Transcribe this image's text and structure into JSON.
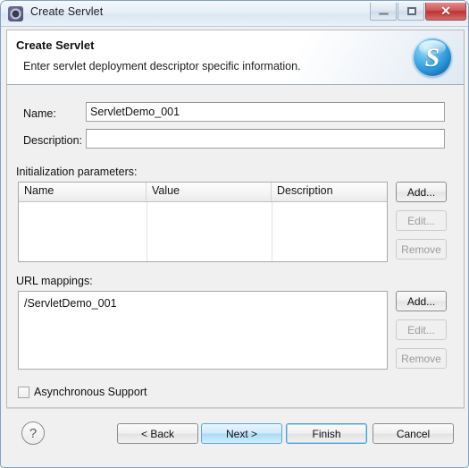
{
  "window": {
    "title": "Create Servlet",
    "icon": "servlet-gear-icon",
    "controls": {
      "minimize": "minimize-icon",
      "maximize": "maximize-icon",
      "close": "✕"
    }
  },
  "banner": {
    "title": "Create Servlet",
    "subtitle": "Enter servlet deployment descriptor specific information.",
    "logo": "S"
  },
  "form": {
    "name_label": "Name:",
    "name_value": "ServletDemo_001",
    "description_label": "Description:",
    "description_value": ""
  },
  "init_params": {
    "section_label": "Initialization parameters:",
    "columns": [
      "Name",
      "Value",
      "Description"
    ],
    "rows": [],
    "buttons": [
      {
        "label": "Add...",
        "enabled": true
      },
      {
        "label": "Edit...",
        "enabled": false
      },
      {
        "label": "Remove",
        "enabled": false
      }
    ]
  },
  "url_mappings": {
    "section_label": "URL mappings:",
    "items": [
      "/ServletDemo_001"
    ],
    "buttons": [
      {
        "label": "Add...",
        "enabled": true
      },
      {
        "label": "Edit...",
        "enabled": false
      },
      {
        "label": "Remove",
        "enabled": false
      }
    ]
  },
  "async": {
    "label": "Asynchronous Support",
    "checked": false
  },
  "footer": {
    "help": "?",
    "back": "< Back",
    "next": "Next >",
    "finish": "Finish",
    "cancel": "Cancel"
  },
  "colors": {
    "window_border": "#7ea2c4",
    "dialog_bg": "#f0f0f0",
    "accent_blue": "#2f9bdc",
    "close_red": "#bb3333",
    "hover_blue": "#a9dbf7"
  }
}
